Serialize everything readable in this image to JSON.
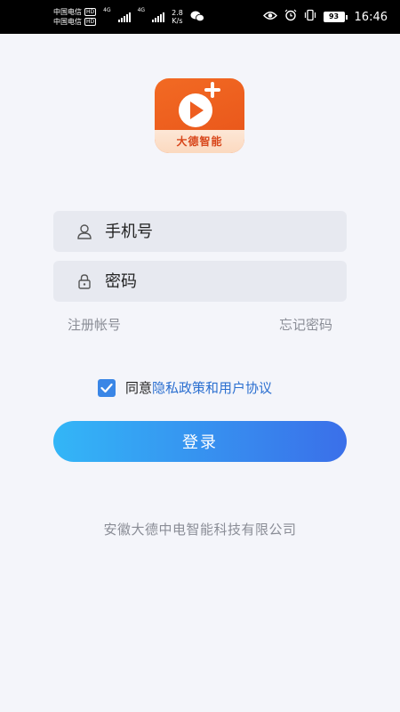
{
  "status_bar": {
    "carrier1": "中国电信",
    "carrier2": "中国电信",
    "hd_label": "HD",
    "net1": "4G",
    "net2": "4G",
    "speed_value": "2.8",
    "speed_unit": "K/s",
    "battery": "93",
    "time": "16:46",
    "icons": [
      "wechat-icon",
      "eye-icon",
      "alarm-icon",
      "vibrate-icon"
    ]
  },
  "logo": {
    "text": "大德智能",
    "colors": {
      "primary": "#f26a23",
      "bottom": "#fde7d6"
    }
  },
  "form": {
    "phone_placeholder": "手机号",
    "password_placeholder": "密码",
    "register_label": "注册帐号",
    "forgot_label": "忘记密码"
  },
  "agreement": {
    "checked": true,
    "prefix": "同意",
    "link_text": "隐私政策和用户协议"
  },
  "login_button": {
    "label": "登录"
  },
  "footer": {
    "company": "安徽大德中电智能科技有限公司"
  },
  "colors": {
    "accent": "#3a86e6",
    "button_gradient_start": "#33b6f7",
    "button_gradient_end": "#3a6fe9",
    "background": "#f4f5fa",
    "field_bg": "#e7e9f0"
  }
}
